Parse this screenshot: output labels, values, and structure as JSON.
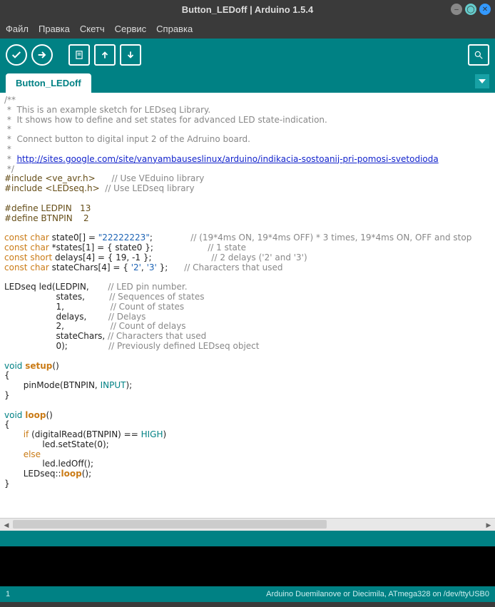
{
  "window": {
    "title": "Button_LEDoff | Arduino 1.5.4"
  },
  "menu": {
    "file": "Файл",
    "edit": "Правка",
    "sketch": "Скетч",
    "tools": "Сервис",
    "help": "Справка"
  },
  "tab": {
    "name": "Button_LEDoff"
  },
  "bottom": {
    "line": "1",
    "board": "Arduino Duemilanove or Diecimila, ATmega328 on /dev/ttyUSB0"
  },
  "code": {
    "c1": "/**",
    "c2": " *  This is an example sketch for LEDseq Library.",
    "c3": " *  It shows how to define and set states for advanced LED state-indication.",
    "c4": " *",
    "c5": " *  Connect button to digital input 2 of the Adruino board.",
    "c6": " *",
    "c7a": " *  ",
    "c7link": "http://sites.google.com/site/vanyambauseslinux/arduino/indikacia-sostoanij-pri-pomosi-svetodioda",
    "c8": " */",
    "inc1a": "#include <ve_avr.h>",
    "inc1b": "      // Use VEduino library",
    "inc2a": "#include <LEDseq.h>",
    "inc2b": "  // Use LEDseq library",
    "def1": "#define LEDPIN   13",
    "def2": "#define BTNPIN    2",
    "l1a": "const char",
    "l1b": " state0[] = ",
    "l1c": "\"22222223\"",
    "l1d": ";              ",
    "l1e": "// (19*4ms ON, 19*4ms OFF) * 3 times, 19*4ms ON, OFF and stop",
    "l2a": "const char",
    "l2b": " *states[1] = { state0 };                    ",
    "l2c": "// 1 state",
    "l3a": "const short",
    "l3b": " delays[4] = { 19, -1 };                      ",
    "l3c": "// 2 delays ('2' and '3')",
    "l4a": "const char",
    "l4b": " stateChars[4] = { ",
    "l4c": "'2'",
    "l4d": ", ",
    "l4e": "'3'",
    "l4f": " };      ",
    "l4g": "// Characters that used",
    "led1a": "LEDseq led(LEDPIN,       ",
    "led1b": "// LED pin number.",
    "led2a": "                   states,         ",
    "led2b": "// Sequences of states",
    "led3a": "                   1,                 ",
    "led3b": "// Count of states",
    "led4a": "                   delays,        ",
    "led4b": "// Delays",
    "led5a": "                   2,                 ",
    "led5b": "// Count of delays",
    "led6a": "                   stateChars, ",
    "led6b": "// Characters that used",
    "led7a": "                   0);               ",
    "led7b": "// Previously defined LEDseq object",
    "setup1a": "void",
    "setup1b": " ",
    "setup1c": "setup",
    "setup1d": "()",
    "brace_o": "{",
    "setup2a": "       pinMode(BTNPIN, ",
    "setup2b": "INPUT",
    "setup2c": ");",
    "brace_c": "}",
    "loop1a": "void",
    "loop1b": " ",
    "loop1c": "loop",
    "loop1d": "()",
    "loop2a": "       ",
    "loop2b": "if",
    "loop2c": " (digitalRead(BTNPIN) == ",
    "loop2d": "HIGH",
    "loop2e": ")",
    "loop3": "              led.setState(0);",
    "loop4a": "       ",
    "loop4b": "else",
    "loop5": "              led.ledOff();",
    "loop6a": "       LEDseq::",
    "loop6b": "loop",
    "loop6c": "();"
  }
}
